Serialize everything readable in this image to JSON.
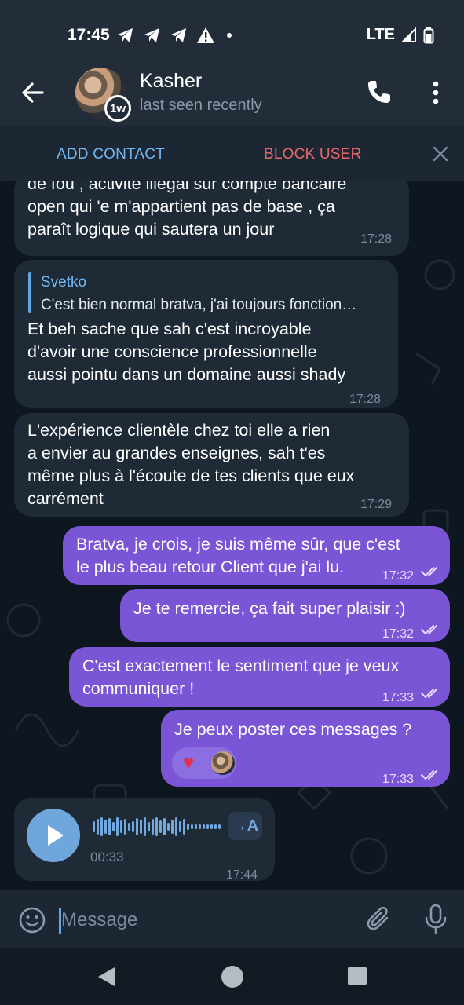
{
  "status_bar": {
    "time": "17:45",
    "network": "LTE"
  },
  "header": {
    "contact_name": "Kasher",
    "contact_status": "last seen recently",
    "story_badge": "1w"
  },
  "action_bar": {
    "add_contact": "ADD CONTACT",
    "block_user": "BLOCK USER"
  },
  "messages": [
    {
      "direction": "in",
      "text": "de fou , activité illégal sur compte bancaire\nopen qui 'e m'appartient pas de base , ça\nparaît logique qui sautera un jour",
      "time": "17:28"
    },
    {
      "direction": "in",
      "reply_to": {
        "name": "Svetko",
        "text": "C'est bien normal bratva, j'ai toujours fonction…"
      },
      "text": "Et beh sache que sah c'est incroyable\nd'avoir une conscience professionnelle\naussi pointu dans un domaine aussi shady",
      "time": "17:28"
    },
    {
      "direction": "in",
      "text": "L'expérience clientèle chez toi elle a rien\na envier au grandes enseignes, sah t'es\nmême plus à l'écoute de tes clients que eux\ncarrément",
      "time": "17:29"
    },
    {
      "direction": "out",
      "text": "Bratva, je crois, je suis même sûr, que c'est\nle plus beau retour Client que j'ai lu.",
      "time": "17:32"
    },
    {
      "direction": "out",
      "text": "Je te remercie, ça fait super plaisir :)",
      "time": "17:32"
    },
    {
      "direction": "out",
      "text": "C'est exactement le sentiment que je veux\ncommuniquer !",
      "time": "17:33"
    },
    {
      "direction": "out",
      "text": "Je peux poster ces messages ?",
      "time": "17:33",
      "reaction": "heart"
    },
    {
      "direction": "in",
      "type": "voice",
      "duration": "00:33",
      "time": "17:44",
      "transcribe_label": "→A"
    }
  ],
  "composer": {
    "placeholder": "Message"
  },
  "colors": {
    "incoming_bubble": "#1f2a37",
    "outgoing_bubble": "#7a55d6",
    "accent_blue": "#71b7f2",
    "danger_red": "#e5696b"
  }
}
